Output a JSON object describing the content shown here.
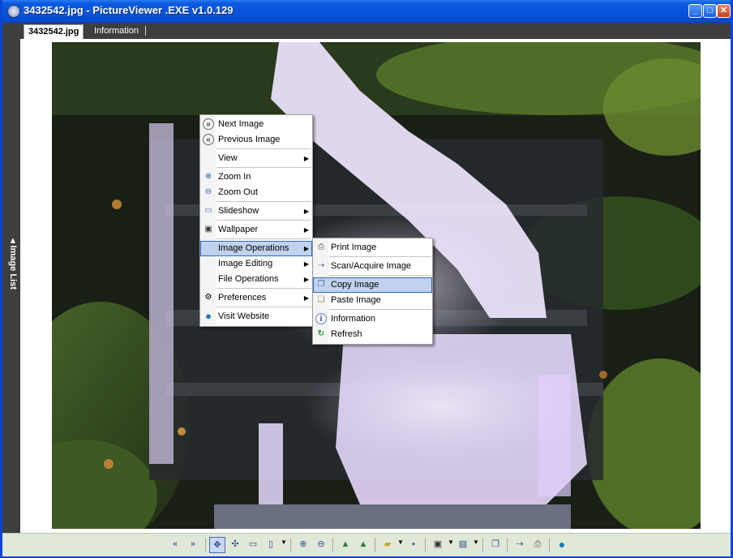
{
  "window": {
    "title": "3432542.jpg - PictureViewer .EXE v1.0.129",
    "minimize": "_",
    "maximize": "□",
    "close": "✕"
  },
  "tabs": [
    {
      "label": "3432542.jpg",
      "active": true
    },
    {
      "label": "Information",
      "active": false
    }
  ],
  "side_panel": {
    "label": "◂ Image List"
  },
  "context_menu": {
    "items": [
      {
        "label": "Next Image",
        "icon": "next-icon",
        "glyph": "»"
      },
      {
        "label": "Previous Image",
        "icon": "previous-icon",
        "glyph": "«"
      },
      {
        "label": "View",
        "submenu": true
      },
      {
        "label": "Zoom In",
        "icon": "zoom-in-icon",
        "glyph": "⊕"
      },
      {
        "label": "Zoom Out",
        "icon": "zoom-out-icon",
        "glyph": "⊖"
      },
      {
        "label": "Slideshow",
        "icon": "slideshow-icon",
        "glyph": "▭",
        "submenu": true
      },
      {
        "label": "Wallpaper",
        "icon": "wallpaper-icon",
        "glyph": "▣",
        "submenu": true
      },
      {
        "label": "Image Operations",
        "submenu": true,
        "highlighted": true
      },
      {
        "label": "Image Editing",
        "submenu": true
      },
      {
        "label": "File Operations",
        "submenu": true
      },
      {
        "label": "Preferences",
        "icon": "preferences-icon",
        "glyph": "⚙",
        "submenu": true
      },
      {
        "label": "Visit Website",
        "icon": "globe-icon",
        "glyph": "●"
      }
    ]
  },
  "submenu": {
    "items": [
      {
        "label": "Print Image",
        "icon": "printer-icon",
        "glyph": "⎙"
      },
      {
        "label": "Scan/Acquire Image",
        "icon": "scanner-icon",
        "glyph": "⇢"
      },
      {
        "label": "Copy Image",
        "icon": "copy-icon",
        "glyph": "❐",
        "highlighted": true
      },
      {
        "label": "Paste Image",
        "icon": "paste-icon",
        "glyph": "❏"
      },
      {
        "label": "Information",
        "icon": "info-icon",
        "glyph": "i"
      },
      {
        "label": "Refresh",
        "icon": "refresh-icon",
        "glyph": "↻"
      }
    ]
  },
  "toolbar": {
    "buttons": [
      {
        "name": "previous-button",
        "icon": "double-left-icon",
        "glyph": "«"
      },
      {
        "name": "next-button",
        "icon": "double-right-icon",
        "glyph": "»"
      },
      {
        "name": "fit-window-button",
        "icon": "fit-icon",
        "glyph": "✥"
      },
      {
        "name": "pan-button",
        "icon": "move-icon",
        "glyph": "✣"
      },
      {
        "name": "window-mode-button",
        "icon": "window-icon",
        "glyph": "▭"
      },
      {
        "name": "slideshow-button",
        "icon": "slideshow-icon",
        "glyph": "▯"
      },
      {
        "name": "zoom-in-button",
        "icon": "zoom-in-icon",
        "glyph": "⊕"
      },
      {
        "name": "zoom-out-button",
        "icon": "zoom-out-icon",
        "glyph": "⊖"
      },
      {
        "name": "rotate-left-button",
        "icon": "mountain-icon",
        "glyph": "▲"
      },
      {
        "name": "rotate-right-button",
        "icon": "mountain-icon",
        "glyph": "▲"
      },
      {
        "name": "open-button",
        "icon": "folder-icon",
        "glyph": "▰"
      },
      {
        "name": "save-button",
        "icon": "floppy-icon",
        "glyph": "▪"
      },
      {
        "name": "wallpaper-button",
        "icon": "wallpaper-icon",
        "glyph": "▣"
      },
      {
        "name": "edit-button",
        "icon": "document-icon",
        "glyph": "▤"
      },
      {
        "name": "copy-button",
        "icon": "copy-icon",
        "glyph": "❐"
      },
      {
        "name": "scan-button",
        "icon": "scanner-icon",
        "glyph": "⇢"
      },
      {
        "name": "print-button",
        "icon": "printer-icon",
        "glyph": "⎙"
      },
      {
        "name": "website-button",
        "icon": "globe-icon",
        "glyph": "●"
      }
    ]
  },
  "colors": {
    "titlebar": "#0653dc",
    "menu_highlight": "#c1d2ee",
    "menu_highlight_border": "#316ac5"
  }
}
